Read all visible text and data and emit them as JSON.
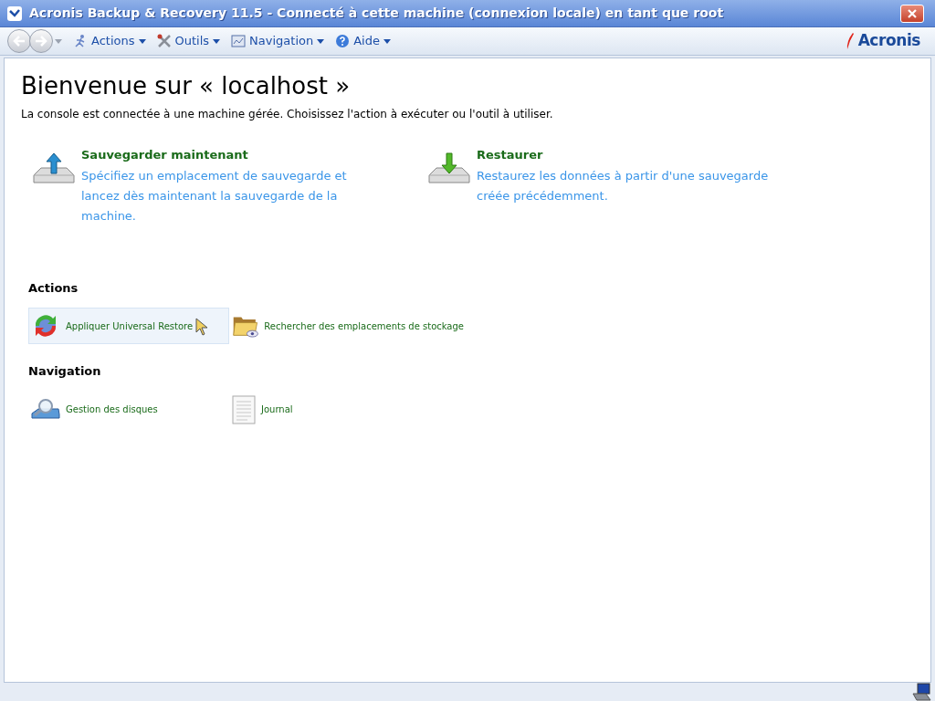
{
  "window": {
    "title": "Acronis Backup & Recovery 11.5 - Connecté à cette machine (connexion locale) en tant que root"
  },
  "toolbar": {
    "menus": [
      {
        "label": "Actions",
        "kind": "actions"
      },
      {
        "label": "Outils",
        "kind": "tools"
      },
      {
        "label": "Navigation",
        "kind": "navigation"
      },
      {
        "label": "Aide",
        "kind": "help"
      }
    ],
    "logo": "Acronis"
  },
  "heading": "Bienvenue sur « localhost »",
  "intro": "La console est connectée à une machine gérée. Choisissez l'action à exécuter ou l'outil à utiliser.",
  "main_tasks": [
    {
      "title": "Sauvegarder maintenant",
      "description": "Spécifiez un emplacement de sauvegarde et lancez dès maintenant la sauvegarde de la machine.",
      "kind": "backup"
    },
    {
      "title": "Restaurer",
      "description": "Restaurez les données à partir d'une sauvegarde créée précédemment.",
      "kind": "restore"
    }
  ],
  "sections": [
    {
      "title": "Actions",
      "items": [
        {
          "label": "Appliquer Universal Restore",
          "kind": "universal",
          "selected": true
        },
        {
          "label": "Rechercher des emplacements de stockage",
          "kind": "folder",
          "selected": false
        }
      ]
    },
    {
      "title": "Navigation",
      "items": [
        {
          "label": "Gestion des disques",
          "kind": "disk",
          "selected": false
        },
        {
          "label": "Journal",
          "kind": "log",
          "selected": false
        }
      ]
    }
  ]
}
